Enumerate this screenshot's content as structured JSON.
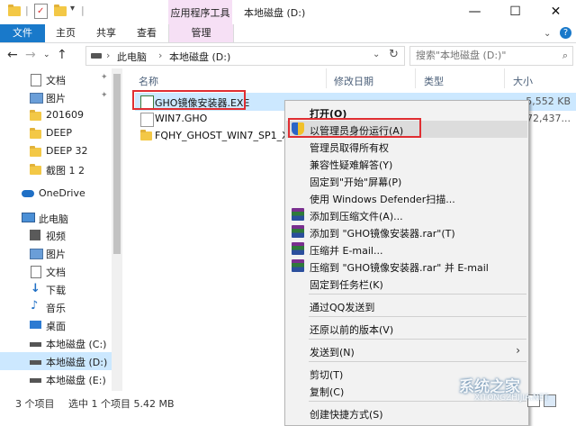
{
  "titlebar": {
    "context_tab": "应用程序工具",
    "title": "本地磁盘 (D:)",
    "minimize": "—",
    "maximize": "☐",
    "close": "✕"
  },
  "ribbon": {
    "tabs": [
      "文件",
      "主页",
      "共享",
      "查看",
      "管理"
    ]
  },
  "addressbar": {
    "segments": [
      "此电脑",
      "本地磁盘 (D:)"
    ],
    "search_placeholder": "搜索\"本地磁盘 (D:)\""
  },
  "navpane": {
    "items": [
      {
        "label": "文档",
        "icon": "document-icon",
        "pinned": true
      },
      {
        "label": "图片",
        "icon": "picture-icon",
        "pinned": true
      },
      {
        "label": "201609",
        "icon": "folder-icon"
      },
      {
        "label": "DEEP",
        "icon": "folder-icon"
      },
      {
        "label": "DEEP 32",
        "icon": "folder-icon"
      },
      {
        "label": "截图 1 2",
        "icon": "folder-icon"
      },
      {
        "label": "OneDrive",
        "icon": "cloud-icon"
      },
      {
        "label": "此电脑",
        "icon": "computer-icon"
      },
      {
        "label": "视频",
        "icon": "video-icon"
      },
      {
        "label": "图片",
        "icon": "picture-icon"
      },
      {
        "label": "文档",
        "icon": "document-icon"
      },
      {
        "label": "下载",
        "icon": "download-icon"
      },
      {
        "label": "音乐",
        "icon": "music-icon"
      },
      {
        "label": "桌面",
        "icon": "desktop-icon"
      },
      {
        "label": "本地磁盘 (C:)",
        "icon": "drive-icon"
      },
      {
        "label": "本地磁盘 (D:)",
        "icon": "drive-icon",
        "selected": true
      },
      {
        "label": "本地磁盘 (E:)",
        "icon": "drive-icon"
      }
    ]
  },
  "columns": [
    "名称",
    "修改日期",
    "类型",
    "大小"
  ],
  "files": [
    {
      "name": "GHO镜像安装器.EXE",
      "size": "5,552 KB",
      "selected": true
    },
    {
      "name": "WIN7.GHO",
      "size": "72,437..."
    },
    {
      "name": "FQHY_GHOST_WIN7_SP1_X64",
      "size": ""
    }
  ],
  "context_menu": {
    "items": [
      {
        "label": "打开(O)",
        "bold": true
      },
      {
        "label": "以管理员身份运行(A)",
        "icon": "uac-shield-icon",
        "highlighted": true
      },
      {
        "label": "管理员取得所有权"
      },
      {
        "label": "兼容性疑难解答(Y)"
      },
      {
        "label": "固定到\"开始\"屏幕(P)"
      },
      {
        "label": "使用 Windows Defender扫描..."
      },
      {
        "label": "添加到压缩文件(A)...",
        "icon": "winrar-icon"
      },
      {
        "label": "添加到 \"GHO镜像安装器.rar\"(T)",
        "icon": "winrar-icon"
      },
      {
        "label": "压缩并 E-mail...",
        "icon": "winrar-icon"
      },
      {
        "label": "压缩到 \"GHO镜像安装器.rar\" 并 E-mail",
        "icon": "winrar-icon"
      },
      {
        "label": "固定到任务栏(K)"
      },
      {
        "label": "通过QQ发送到"
      },
      {
        "label": "还原以前的版本(V)"
      },
      {
        "label": "发送到(N)",
        "submenu": true
      },
      {
        "label": "剪切(T)"
      },
      {
        "label": "复制(C)"
      },
      {
        "label": "创建快捷方式(S)"
      }
    ]
  },
  "statusbar": {
    "count": "3 个项目",
    "selected": "选中 1 个项目  5.42 MB"
  },
  "watermark": {
    "main": "系统之家",
    "sub": "XITONGZHIJIA.NET"
  },
  "colors": {
    "accent": "#1979ca",
    "context_tab_bg": "#f6e0f5",
    "selection": "#cce8ff",
    "highlight_box": "#e02e32"
  }
}
